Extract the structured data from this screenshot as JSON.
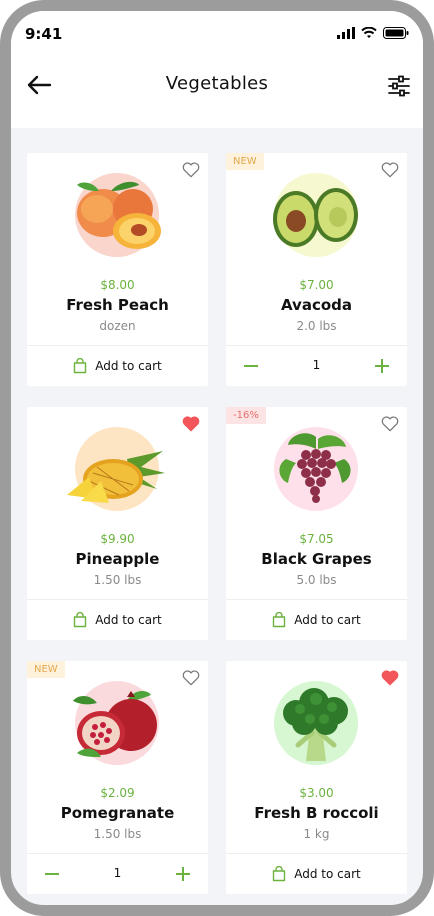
{
  "status": {
    "time": "9:41"
  },
  "header": {
    "title": "Vegetables"
  },
  "colors": {
    "accent": "#6cb23f",
    "favorite": "#f2555a"
  },
  "actions": {
    "add_to_cart": "Add to cart"
  },
  "products": [
    {
      "price": "$8.00",
      "name": "Fresh Peach",
      "unit": "dozen",
      "badge": "",
      "favorite": false,
      "quantity": "",
      "image": "peach"
    },
    {
      "price": "$7.00",
      "name": "Avacoda",
      "unit": "2.0 lbs",
      "badge": "NEW",
      "favorite": false,
      "quantity": "1",
      "image": "avocado"
    },
    {
      "price": "$9.90",
      "name": "Pineapple",
      "unit": "1.50 lbs",
      "badge": "",
      "favorite": true,
      "quantity": "",
      "image": "pineapple"
    },
    {
      "price": "$7.05",
      "name": "Black Grapes",
      "unit": "5.0 lbs",
      "badge": "-16%",
      "favorite": false,
      "quantity": "",
      "image": "grapes"
    },
    {
      "price": "$2.09",
      "name": "Pomegranate",
      "unit": "1.50 lbs",
      "badge": "NEW",
      "favorite": false,
      "quantity": "1",
      "image": "pomegranate"
    },
    {
      "price": "$3.00",
      "name": "Fresh B roccoli",
      "unit": "1 kg",
      "badge": "",
      "favorite": true,
      "quantity": "",
      "image": "broccoli"
    }
  ]
}
